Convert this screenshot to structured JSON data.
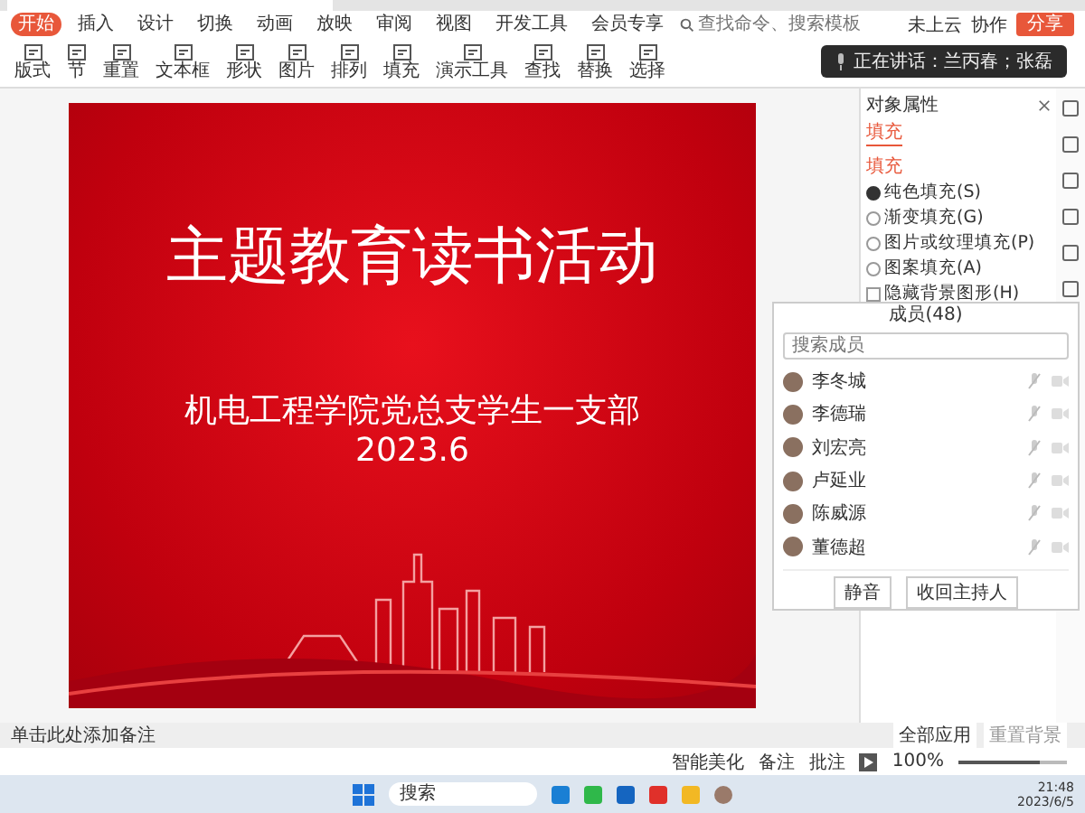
{
  "menu": {
    "tabs": [
      {
        "label": "开始",
        "selected": true
      },
      {
        "label": "插入",
        "selected": false
      },
      {
        "label": "设计",
        "selected": false
      },
      {
        "label": "切换",
        "selected": false
      },
      {
        "label": "动画",
        "selected": false
      },
      {
        "label": "放映",
        "selected": false
      },
      {
        "label": "审阅",
        "selected": false
      },
      {
        "label": "视图",
        "selected": false
      },
      {
        "label": "开发工具",
        "selected": false
      },
      {
        "label": "会员专享",
        "selected": false
      }
    ],
    "command_search": {
      "placeholder": "查找命令、搜索模板"
    },
    "cloud_status": "未上云",
    "collaborate": "协作",
    "share": "分享"
  },
  "toolbar": {
    "items": [
      "版式",
      "节",
      "重置",
      "文本框",
      "形状",
      "图片",
      "排列",
      "填充",
      "演示工具",
      "查找",
      "替换",
      "选择"
    ]
  },
  "speaking_banner": "正在讲话：兰丙春；张磊",
  "slide": {
    "title": "主题教育读书活动",
    "subtitle": "机电工程学院党总支学生一支部",
    "date": "2023.6"
  },
  "properties_panel": {
    "title": "对象属性",
    "tab": "填充",
    "section": "填充",
    "fill_options": [
      {
        "label": "纯色填充(S)",
        "selected": true
      },
      {
        "label": "渐变填充(G)",
        "selected": false
      },
      {
        "label": "图片或纹理填充(P)",
        "selected": false
      },
      {
        "label": "图案填充(A)",
        "selected": false
      }
    ],
    "hide_background": {
      "label": "隐藏背景图形(H)",
      "checked": false
    }
  },
  "members_window": {
    "title": "成员(48)",
    "search": {
      "placeholder": "搜索成员"
    },
    "members": [
      {
        "name": "李冬城"
      },
      {
        "name": "李德瑞"
      },
      {
        "name": "刘宏亮"
      },
      {
        "name": "卢延业"
      },
      {
        "name": "陈威源"
      },
      {
        "name": "董德超"
      }
    ],
    "buttons": [
      "静音",
      "收回主持人"
    ]
  },
  "notes": {
    "placeholder": "单击此处添加备注"
  },
  "background_buttons": [
    "全部应用",
    "重置背景"
  ],
  "status_bar": {
    "beautify": "智能美化",
    "notes": "备注",
    "comments": "批注",
    "zoom": "100%",
    "zoom_slider": {
      "level": 0.75
    }
  },
  "taskbar": {
    "search": "搜索",
    "time": "21:48",
    "date": "2023/6/5"
  }
}
